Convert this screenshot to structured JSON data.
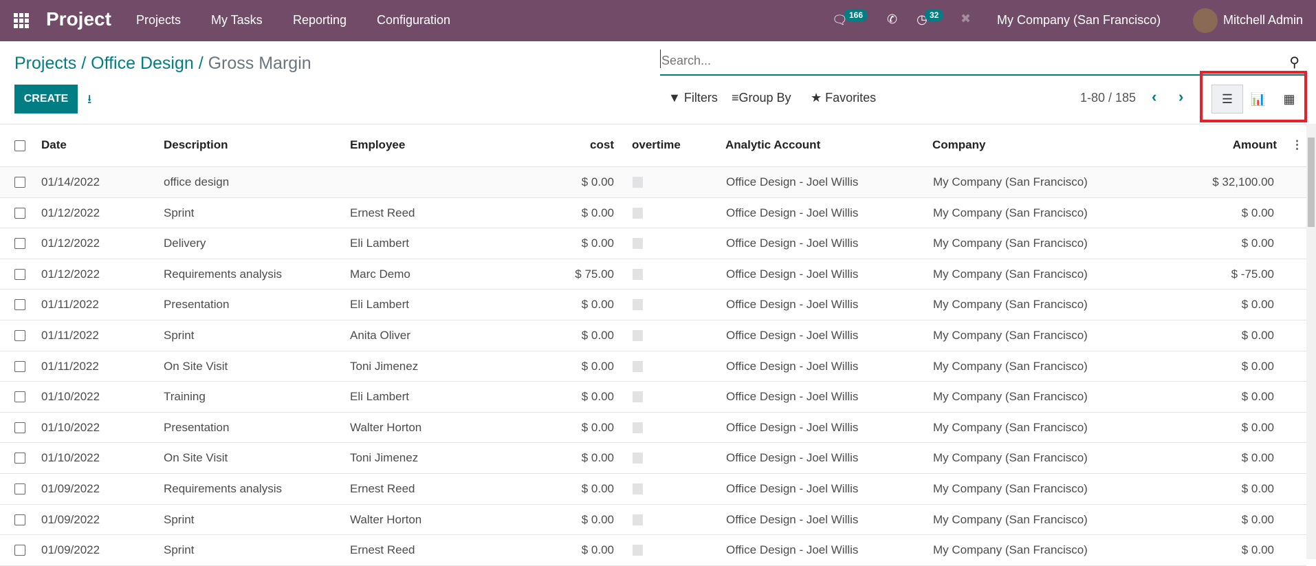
{
  "nav": {
    "app": "Project",
    "menus": [
      "Projects",
      "My Tasks",
      "Reporting",
      "Configuration"
    ],
    "messages_count": "166",
    "activities_count": "32",
    "company": "My Company (San Francisco)",
    "user": "Mitchell Admin"
  },
  "breadcrumb": {
    "root": "Projects",
    "parent": "Office Design",
    "current": "Gross Margin"
  },
  "toolbar": {
    "create": "CREATE",
    "filters": "Filters",
    "group_by": "Group By",
    "favorites": "Favorites",
    "pager": "1-80 / 185",
    "active_view": "list"
  },
  "search": {
    "placeholder": "Search..."
  },
  "columns": [
    "Date",
    "Description",
    "Employee",
    "cost",
    "overtime",
    "Analytic Account",
    "Company",
    "Amount"
  ],
  "rows": [
    [
      "01/14/2022",
      "office design",
      "",
      "$ 0.00",
      "Office Design - Joel Willis",
      "My Company (San Francisco)",
      "$ 32,100.00"
    ],
    [
      "01/12/2022",
      "Sprint",
      "Ernest Reed",
      "$ 0.00",
      "Office Design - Joel Willis",
      "My Company (San Francisco)",
      "$ 0.00"
    ],
    [
      "01/12/2022",
      "Delivery",
      "Eli Lambert",
      "$ 0.00",
      "Office Design - Joel Willis",
      "My Company (San Francisco)",
      "$ 0.00"
    ],
    [
      "01/12/2022",
      "Requirements analysis",
      "Marc Demo",
      "$ 75.00",
      "Office Design - Joel Willis",
      "My Company (San Francisco)",
      "$ -75.00"
    ],
    [
      "01/11/2022",
      "Presentation",
      "Eli Lambert",
      "$ 0.00",
      "Office Design - Joel Willis",
      "My Company (San Francisco)",
      "$ 0.00"
    ],
    [
      "01/11/2022",
      "Sprint",
      "Anita Oliver",
      "$ 0.00",
      "Office Design - Joel Willis",
      "My Company (San Francisco)",
      "$ 0.00"
    ],
    [
      "01/11/2022",
      "On Site Visit",
      "Toni Jimenez",
      "$ 0.00",
      "Office Design - Joel Willis",
      "My Company (San Francisco)",
      "$ 0.00"
    ],
    [
      "01/10/2022",
      "Training",
      "Eli Lambert",
      "$ 0.00",
      "Office Design - Joel Willis",
      "My Company (San Francisco)",
      "$ 0.00"
    ],
    [
      "01/10/2022",
      "Presentation",
      "Walter Horton",
      "$ 0.00",
      "Office Design - Joel Willis",
      "My Company (San Francisco)",
      "$ 0.00"
    ],
    [
      "01/10/2022",
      "On Site Visit",
      "Toni Jimenez",
      "$ 0.00",
      "Office Design - Joel Willis",
      "My Company (San Francisco)",
      "$ 0.00"
    ],
    [
      "01/09/2022",
      "Requirements analysis",
      "Ernest Reed",
      "$ 0.00",
      "Office Design - Joel Willis",
      "My Company (San Francisco)",
      "$ 0.00"
    ],
    [
      "01/09/2022",
      "Sprint",
      "Walter Horton",
      "$ 0.00",
      "Office Design - Joel Willis",
      "My Company (San Francisco)",
      "$ 0.00"
    ],
    [
      "01/09/2022",
      "Sprint",
      "Ernest Reed",
      "$ 0.00",
      "Office Design - Joel Willis",
      "My Company (San Francisco)",
      "$ 0.00"
    ]
  ],
  "colors": {
    "navbar": "#714b67",
    "primary": "#017e84",
    "highlight": "#e8202a"
  }
}
